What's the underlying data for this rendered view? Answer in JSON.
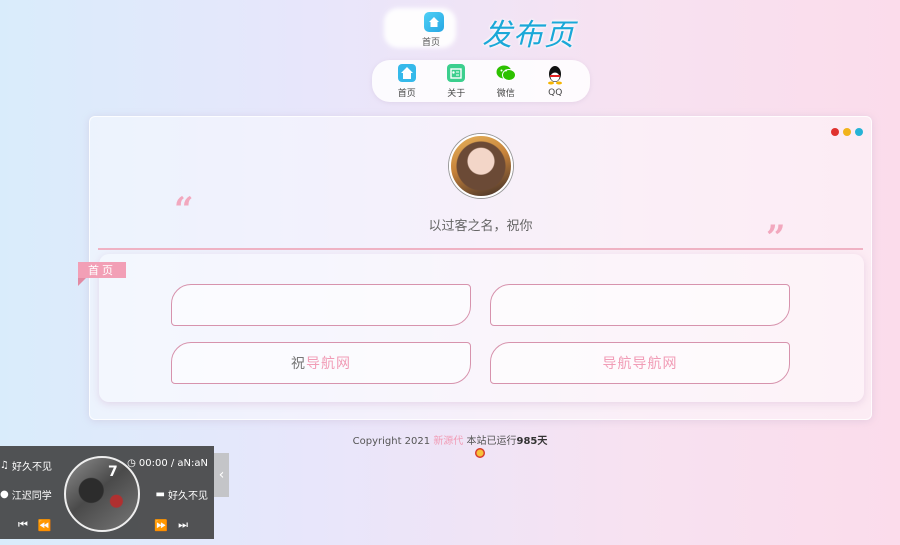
{
  "logo": {
    "home_label": "首页",
    "title": "发布页"
  },
  "nav": {
    "items": [
      {
        "label": "首页",
        "icon": "home-icon",
        "color": "#35b9ea"
      },
      {
        "label": "关于",
        "icon": "about-icon",
        "color": "#3ccf8e"
      },
      {
        "label": "微信",
        "icon": "wechat-icon",
        "color": "#2dc100"
      },
      {
        "label": "QQ",
        "icon": "qq-icon",
        "color": "#111111"
      }
    ]
  },
  "card": {
    "motto": "以过客之名，祝你",
    "quote_open": "“",
    "quote_close": "”",
    "window_dots": [
      "#e0322f",
      "#f1b31b",
      "#26b3d6"
    ],
    "ribbon": "首页",
    "links": [
      {
        "label": "",
        "faded": ""
      },
      {
        "label": "",
        "faded": ""
      },
      {
        "prefix": "祝",
        "label": "导航网"
      },
      {
        "prefix": "",
        "label": "导航导航网"
      }
    ]
  },
  "footer": {
    "copyright": "Copyright 2021",
    "brand": "新源代",
    "running": "本站已运行",
    "days": "985",
    "days_unit": "天"
  },
  "player": {
    "song": "好久不见",
    "time": "00:00 / aN:aN",
    "artist": "江迟同学",
    "playlist": "好久不见",
    "disc_mark": "7",
    "toggle": "‹"
  },
  "colors": {
    "accent_pink": "#f19cb6",
    "accent_blue": "#1aa8d8"
  }
}
